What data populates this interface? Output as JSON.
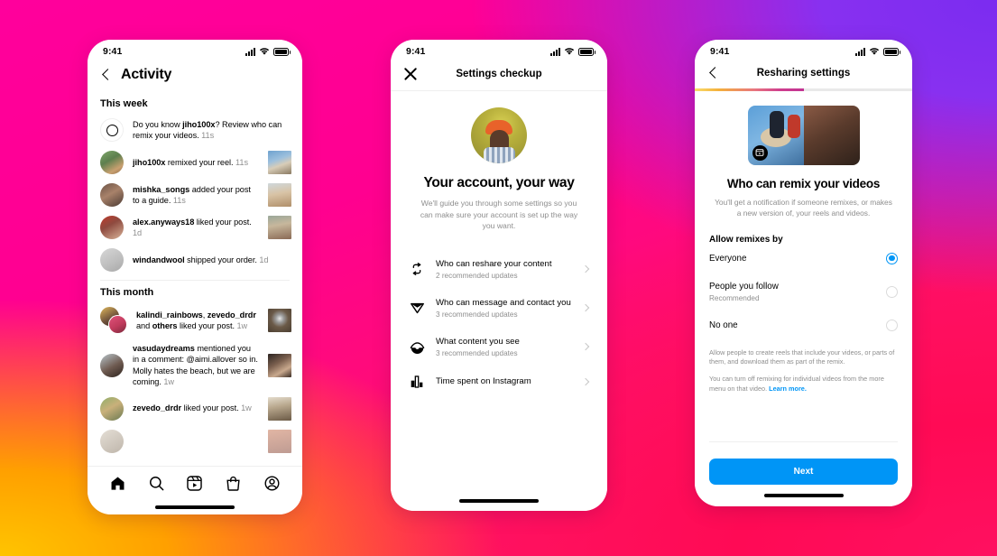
{
  "background": {
    "colors": [
      "#FF009C",
      "#7B2CF0",
      "#FF1060",
      "#FFC400"
    ]
  },
  "accent": {
    "blue": "#0095F6",
    "gray": "#8e8e8e"
  },
  "status_bar": {
    "time": "9:41"
  },
  "phone1": {
    "nav": {
      "title": "Activity",
      "back_icon": "chevron-left-icon"
    },
    "sections": [
      {
        "header": "This week",
        "items": [
          {
            "avatar": "ring-icon",
            "avatar_style": "ring",
            "text_parts": [
              {
                "t": "Do you know ",
                "b": false
              },
              {
                "t": "jiho100x",
                "b": true
              },
              {
                "t": "? Review who can remix your videos. ",
                "b": false
              }
            ],
            "time": "11s",
            "thumb": false
          },
          {
            "avatar": "avatar-jiho100x",
            "text_parts": [
              {
                "t": "jiho100x",
                "b": true
              },
              {
                "t": " remixed your reel. ",
                "b": false
              }
            ],
            "time": "11s",
            "thumb": true
          },
          {
            "avatar": "avatar-mishka-songs",
            "text_parts": [
              {
                "t": "mishka_songs",
                "b": true
              },
              {
                "t": " added your post to a guide. ",
                "b": false
              }
            ],
            "time": "11s",
            "thumb": true
          },
          {
            "avatar": "avatar-alex-anyways18",
            "text_parts": [
              {
                "t": "alex.anyways18",
                "b": true
              },
              {
                "t": " liked your post. ",
                "b": false
              }
            ],
            "time": "1d",
            "thumb": true
          },
          {
            "avatar": "avatar-windandwool",
            "text_parts": [
              {
                "t": "windandwool",
                "b": true
              },
              {
                "t": " shipped your order. ",
                "b": false
              }
            ],
            "time": "1d",
            "thumb": false
          }
        ]
      },
      {
        "header": "This month",
        "items": [
          {
            "avatar": "avatar-stacked",
            "avatar_style": "double",
            "text_parts": [
              {
                "t": "kalindi_rainbows",
                "b": true
              },
              {
                "t": ", ",
                "b": false
              },
              {
                "t": "zevedo_drdr",
                "b": true
              },
              {
                "t": " and ",
                "b": false
              },
              {
                "t": "others",
                "b": true
              },
              {
                "t": " liked your post. ",
                "b": false
              }
            ],
            "time": "1w",
            "thumb": true
          },
          {
            "avatar": "avatar-vasudaydreams",
            "text_parts": [
              {
                "t": "vasudaydreams",
                "b": true
              },
              {
                "t": " mentioned you in a comment: @aimi.allover so in. Molly hates the beach, but we are coming. ",
                "b": false
              }
            ],
            "time": "1w",
            "thumb": true
          },
          {
            "avatar": "avatar-zevedo-drdr",
            "text_parts": [
              {
                "t": "zevedo_drdr",
                "b": true
              },
              {
                "t": " liked your post. ",
                "b": false
              }
            ],
            "time": "1w",
            "thumb": true
          }
        ]
      }
    ],
    "tabbar": [
      {
        "icon": "home-icon",
        "label": "Home",
        "active": true
      },
      {
        "icon": "search-icon",
        "label": "Search",
        "active": false
      },
      {
        "icon": "reels-icon",
        "label": "Reels",
        "active": false
      },
      {
        "icon": "shop-icon",
        "label": "Shop",
        "active": false
      },
      {
        "icon": "profile-icon",
        "label": "Profile",
        "active": false
      }
    ]
  },
  "phone2": {
    "nav": {
      "title": "Settings checkup",
      "close_icon": "close-icon"
    },
    "hero_title": "Your account, your way",
    "hero_sub": "We'll guide you through some settings so you can make sure your account is set up the way you want.",
    "settings": [
      {
        "icon": "reshare-icon",
        "title": "Who can reshare your content",
        "subtitle": "2 recommended updates"
      },
      {
        "icon": "send-icon",
        "title": "Who can message and contact you",
        "subtitle": "3 recommended updates"
      },
      {
        "icon": "eye-icon",
        "title": "What content you see",
        "subtitle": "3 recommended updates"
      },
      {
        "icon": "bar-chart-icon",
        "title": "Time spent on Instagram",
        "subtitle": ""
      }
    ]
  },
  "phone3": {
    "nav": {
      "title": "Resharing settings",
      "back_icon": "chevron-left-icon"
    },
    "progress_percent": 50,
    "hero_title": "Who can remix your videos",
    "hero_sub": "You'll get a notification if someone remixes, or makes a new version of, your reels and videos.",
    "group_label": "Allow remixes by",
    "options": [
      {
        "title": "Everyone",
        "subtitle": "",
        "selected": true
      },
      {
        "title": "People you follow",
        "subtitle": "Recommended",
        "selected": false
      },
      {
        "title": "No one",
        "subtitle": "",
        "selected": false
      }
    ],
    "fine_print_1": "Allow people to create reels that include your videos, or parts of them, and download them as part of the remix.",
    "fine_print_2": "You can turn off remixing for individual videos from the more menu on that video. ",
    "learn_more": "Learn more.",
    "next_label": "Next"
  }
}
